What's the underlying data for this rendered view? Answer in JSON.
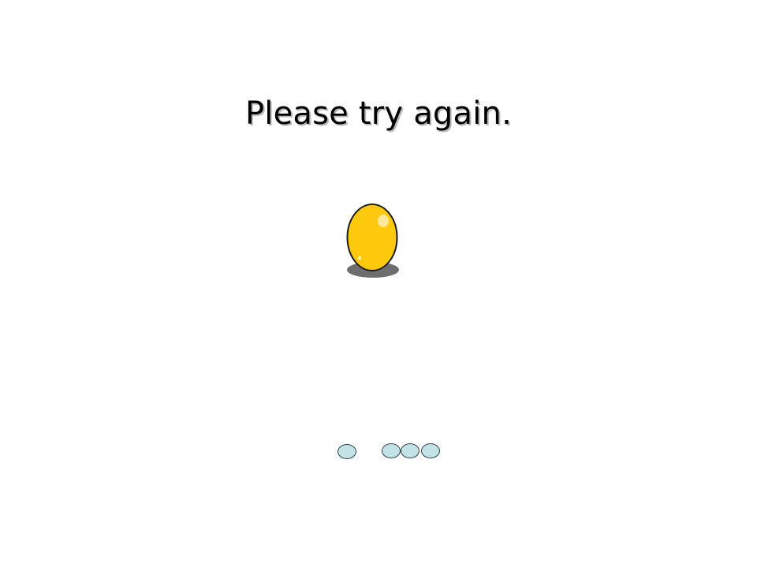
{
  "feedback": {
    "message": "Please try again."
  },
  "colors": {
    "egg_fill": "#ffc90e",
    "egg_outline": "#1b1b1b",
    "egg_shadow": "#6e6e6e",
    "dot_fill": "#c3e2e6",
    "dot_outline": "#2f3f43"
  },
  "icons": {
    "egg": "golden-egg-icon",
    "dot": "progress-dot-icon"
  },
  "progress": {
    "total_dots": 4
  }
}
